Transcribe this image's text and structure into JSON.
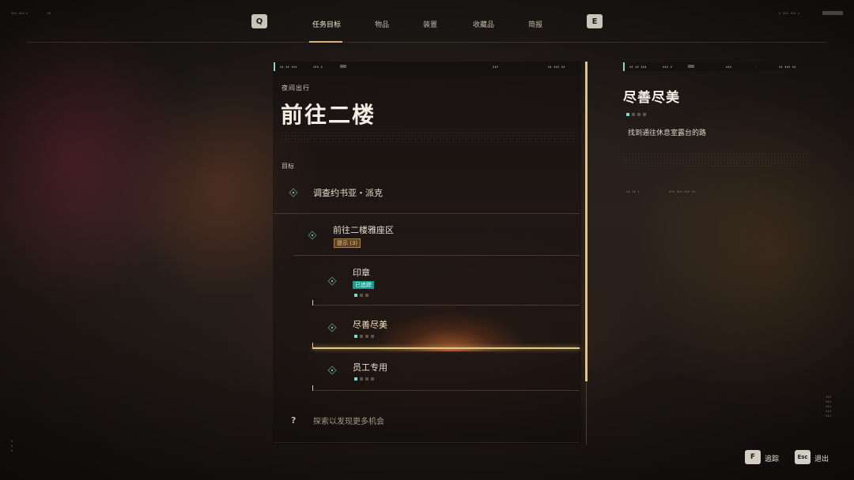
{
  "nav": {
    "prev_key": "Q",
    "next_key": "E",
    "tabs": [
      {
        "label": "任务目标",
        "active": true
      },
      {
        "label": "物品",
        "active": false
      },
      {
        "label": "装置",
        "active": false
      },
      {
        "label": "收藏品",
        "active": false
      },
      {
        "label": "简报",
        "active": false
      }
    ]
  },
  "left_panel": {
    "subtitle": "夜间出行",
    "title": "前往二楼",
    "section_label": "目标",
    "objectives": [
      {
        "label": "调查约书亚・派克"
      },
      {
        "label": "前往二楼雅座区",
        "tag": "提示 (3)"
      },
      {
        "label": "印章",
        "tag": "已追踪",
        "progress_done": 1,
        "progress_total": 3
      },
      {
        "label": "尽善尽美",
        "selected": true,
        "progress_done": 1,
        "progress_total": 4
      },
      {
        "label": "员工专用",
        "progress_done": 1,
        "progress_total": 4
      }
    ],
    "explore_icon": "?",
    "explore_text": "探索以发现更多机会"
  },
  "right_panel": {
    "title": "尽善尽美",
    "progress_done": 1,
    "progress_total": 4,
    "description": "找到通往休息室露台的路"
  },
  "hints": [
    {
      "key": "F",
      "label": "追踪"
    },
    {
      "key": "Esc",
      "label": "退出"
    }
  ],
  "colors": {
    "accent_gold": "#e0c489",
    "accent_teal": "#6fdcd2",
    "tracked_tag": "#139c92"
  }
}
